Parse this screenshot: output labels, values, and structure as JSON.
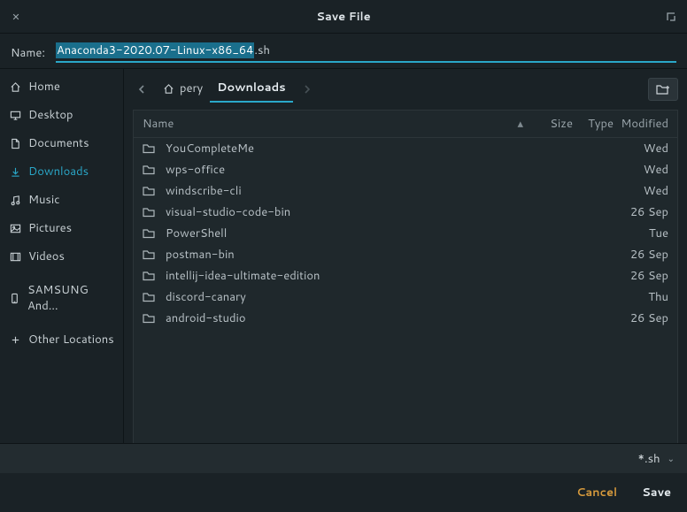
{
  "titlebar": {
    "title": "Save File"
  },
  "name": {
    "label": "Name:",
    "value_selected": "Anaconda3-2020.07-Linux-x86_64",
    "value_ext": ".sh"
  },
  "sidebar": {
    "items": [
      {
        "icon": "home-icon",
        "label": "Home"
      },
      {
        "icon": "desktop-icon",
        "label": "Desktop"
      },
      {
        "icon": "documents-icon",
        "label": "Documents"
      },
      {
        "icon": "downloads-icon",
        "label": "Downloads",
        "active": true
      },
      {
        "icon": "music-icon",
        "label": "Music"
      },
      {
        "icon": "pictures-icon",
        "label": "Pictures"
      },
      {
        "icon": "videos-icon",
        "label": "Videos"
      },
      {
        "icon": "device-icon",
        "label": "SAMSUNG And…"
      },
      {
        "icon": "plus-icon",
        "label": "Other Locations"
      }
    ]
  },
  "path": {
    "crumbs": [
      {
        "label": "pery",
        "home": true
      },
      {
        "label": "Downloads",
        "active": true
      }
    ]
  },
  "columns": {
    "name": "Name",
    "size": "Size",
    "type": "Type",
    "modified": "Modified"
  },
  "files": [
    {
      "name": "YouCompleteMe",
      "size": "",
      "type": "",
      "modified": "Wed"
    },
    {
      "name": "wps-office",
      "size": "",
      "type": "",
      "modified": "Wed"
    },
    {
      "name": "windscribe-cli",
      "size": "",
      "type": "",
      "modified": "Wed"
    },
    {
      "name": "visual-studio-code-bin",
      "size": "",
      "type": "",
      "modified": "26 Sep"
    },
    {
      "name": "PowerShell",
      "size": "",
      "type": "",
      "modified": "Tue"
    },
    {
      "name": "postman-bin",
      "size": "",
      "type": "",
      "modified": "26 Sep"
    },
    {
      "name": "intellij-idea-ultimate-edition",
      "size": "",
      "type": "",
      "modified": "26 Sep"
    },
    {
      "name": "discord-canary",
      "size": "",
      "type": "",
      "modified": "Thu"
    },
    {
      "name": "android-studio",
      "size": "",
      "type": "",
      "modified": "26 Sep"
    }
  ],
  "filter": {
    "label": "*.sh"
  },
  "actions": {
    "cancel": "Cancel",
    "save": "Save"
  }
}
